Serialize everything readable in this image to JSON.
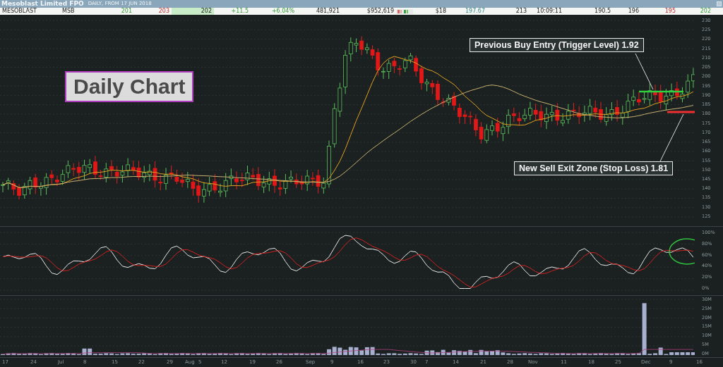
{
  "header": {
    "title": "Mesoblast Limited FPO",
    "subtitle": "DAILY, FROM 17 JUN 2018"
  },
  "quote_row": [
    {
      "text": "MESOBLAST",
      "kind": "plain",
      "highlight": false
    },
    {
      "text": "MSB",
      "kind": "plain",
      "highlight": false
    },
    {
      "text": "201",
      "kind": "up",
      "highlight": false
    },
    {
      "text": "203",
      "kind": "down",
      "highlight": false
    },
    {
      "text": "202",
      "kind": "plain",
      "highlight": true
    },
    {
      "text": "+11.5",
      "kind": "up",
      "highlight": false
    },
    {
      "text": "+6.04%",
      "kind": "up",
      "highlight": false
    },
    {
      "text": "481,921",
      "kind": "plain",
      "highlight": false
    },
    {
      "text": "$952,619",
      "kind": "plain",
      "highlight": false
    },
    {
      "text": "$18",
      "kind": "plain",
      "highlight": false
    },
    {
      "text": "197.67",
      "kind": "average",
      "highlight": false
    },
    {
      "text": "213",
      "kind": "plain",
      "highlight": false
    },
    {
      "text": "10:09:11",
      "kind": "plain",
      "highlight": false
    },
    {
      "text": "190.5",
      "kind": "plain",
      "highlight": false
    },
    {
      "text": "196",
      "kind": "plain",
      "highlight": false
    },
    {
      "text": "195",
      "kind": "down",
      "highlight": false
    },
    {
      "text": "202",
      "kind": "up",
      "highlight": false
    }
  ],
  "price_panel": {
    "axis": [
      "230",
      "225",
      "220",
      "215",
      "210",
      "205",
      "200",
      "195",
      "190",
      "185",
      "180",
      "175",
      "170",
      "165",
      "160",
      "155",
      "150",
      "145",
      "140",
      "135",
      "130",
      "125"
    ],
    "label": "Daily Chart",
    "callouts": [
      {
        "kind": "buy",
        "text": "Previous Buy Entry (Trigger Level) 1.92"
      },
      {
        "kind": "sell",
        "text": "New Sell Exit Zone (Stop Loss) 1.81"
      }
    ]
  },
  "oscillator_panel": {
    "axis": [
      "100%",
      "80%",
      "60%",
      "40%",
      "20%",
      "0%"
    ]
  },
  "volume_panel": {
    "axis": [
      "30M",
      "25M",
      "20M",
      "15M",
      "10M",
      "5M",
      "0M"
    ]
  },
  "x_axis": [
    "17",
    "24",
    "Jul",
    "8",
    "15",
    "22",
    "29",
    "Aug",
    "5",
    "12",
    "19",
    "26",
    "Sep",
    "9",
    "16",
    "23",
    "30",
    "7",
    "14",
    "21",
    "28",
    "Nov",
    "11",
    "18",
    "25",
    "Dec",
    "9",
    "16"
  ]
}
